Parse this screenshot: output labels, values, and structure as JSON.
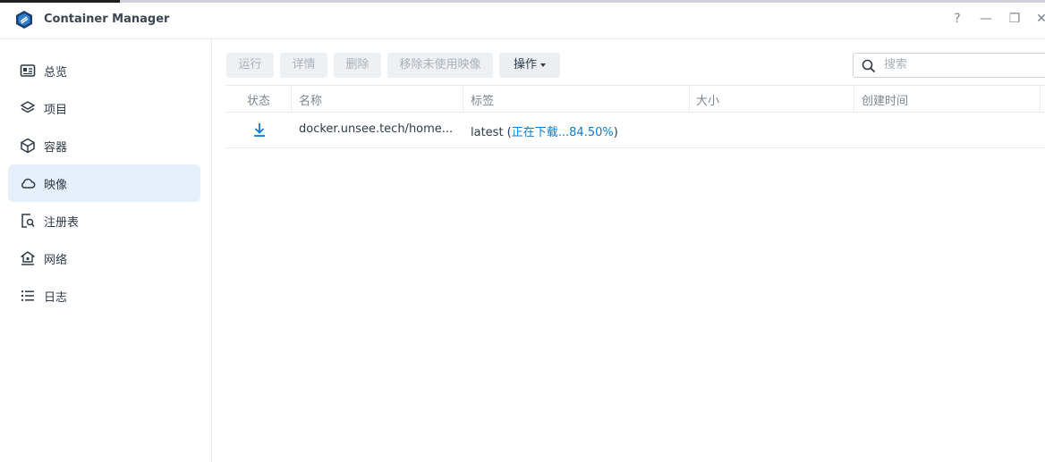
{
  "window": {
    "title": "Container Manager",
    "controls": {
      "help": "?",
      "minimize": "—",
      "restore": "❐",
      "close": "✕"
    }
  },
  "sidebar": {
    "items": [
      {
        "label": "总览",
        "icon": "overview-icon"
      },
      {
        "label": "项目",
        "icon": "layers-icon"
      },
      {
        "label": "容器",
        "icon": "cube-icon"
      },
      {
        "label": "映像",
        "icon": "cloud-icon",
        "active": true
      },
      {
        "label": "注册表",
        "icon": "registry-search-icon"
      },
      {
        "label": "网络",
        "icon": "network-home-icon"
      },
      {
        "label": "日志",
        "icon": "list-icon"
      }
    ]
  },
  "toolbar": {
    "run": "运行",
    "details": "详情",
    "delete": "删除",
    "remove_unused": "移除未使用映像",
    "actions": "操作"
  },
  "search": {
    "placeholder": "搜索"
  },
  "table": {
    "headers": {
      "status": "状态",
      "name": "名称",
      "tag": "标签",
      "size": "大小",
      "created": "创建时间"
    },
    "rows": [
      {
        "status_icon": "download-icon",
        "name": "docker.unsee.tech/home...",
        "tag": "latest",
        "tag_open": " (",
        "progress_text": "正在下载...84.50%",
        "tag_close": ")",
        "progress_percent": 84.5,
        "size": "",
        "created": ""
      }
    ]
  },
  "colors": {
    "accent": "#0a7bd1",
    "active_nav_bg": "#e6f0fa",
    "disabled_text": "#a9b1b9",
    "header_text": "#7c8690"
  }
}
